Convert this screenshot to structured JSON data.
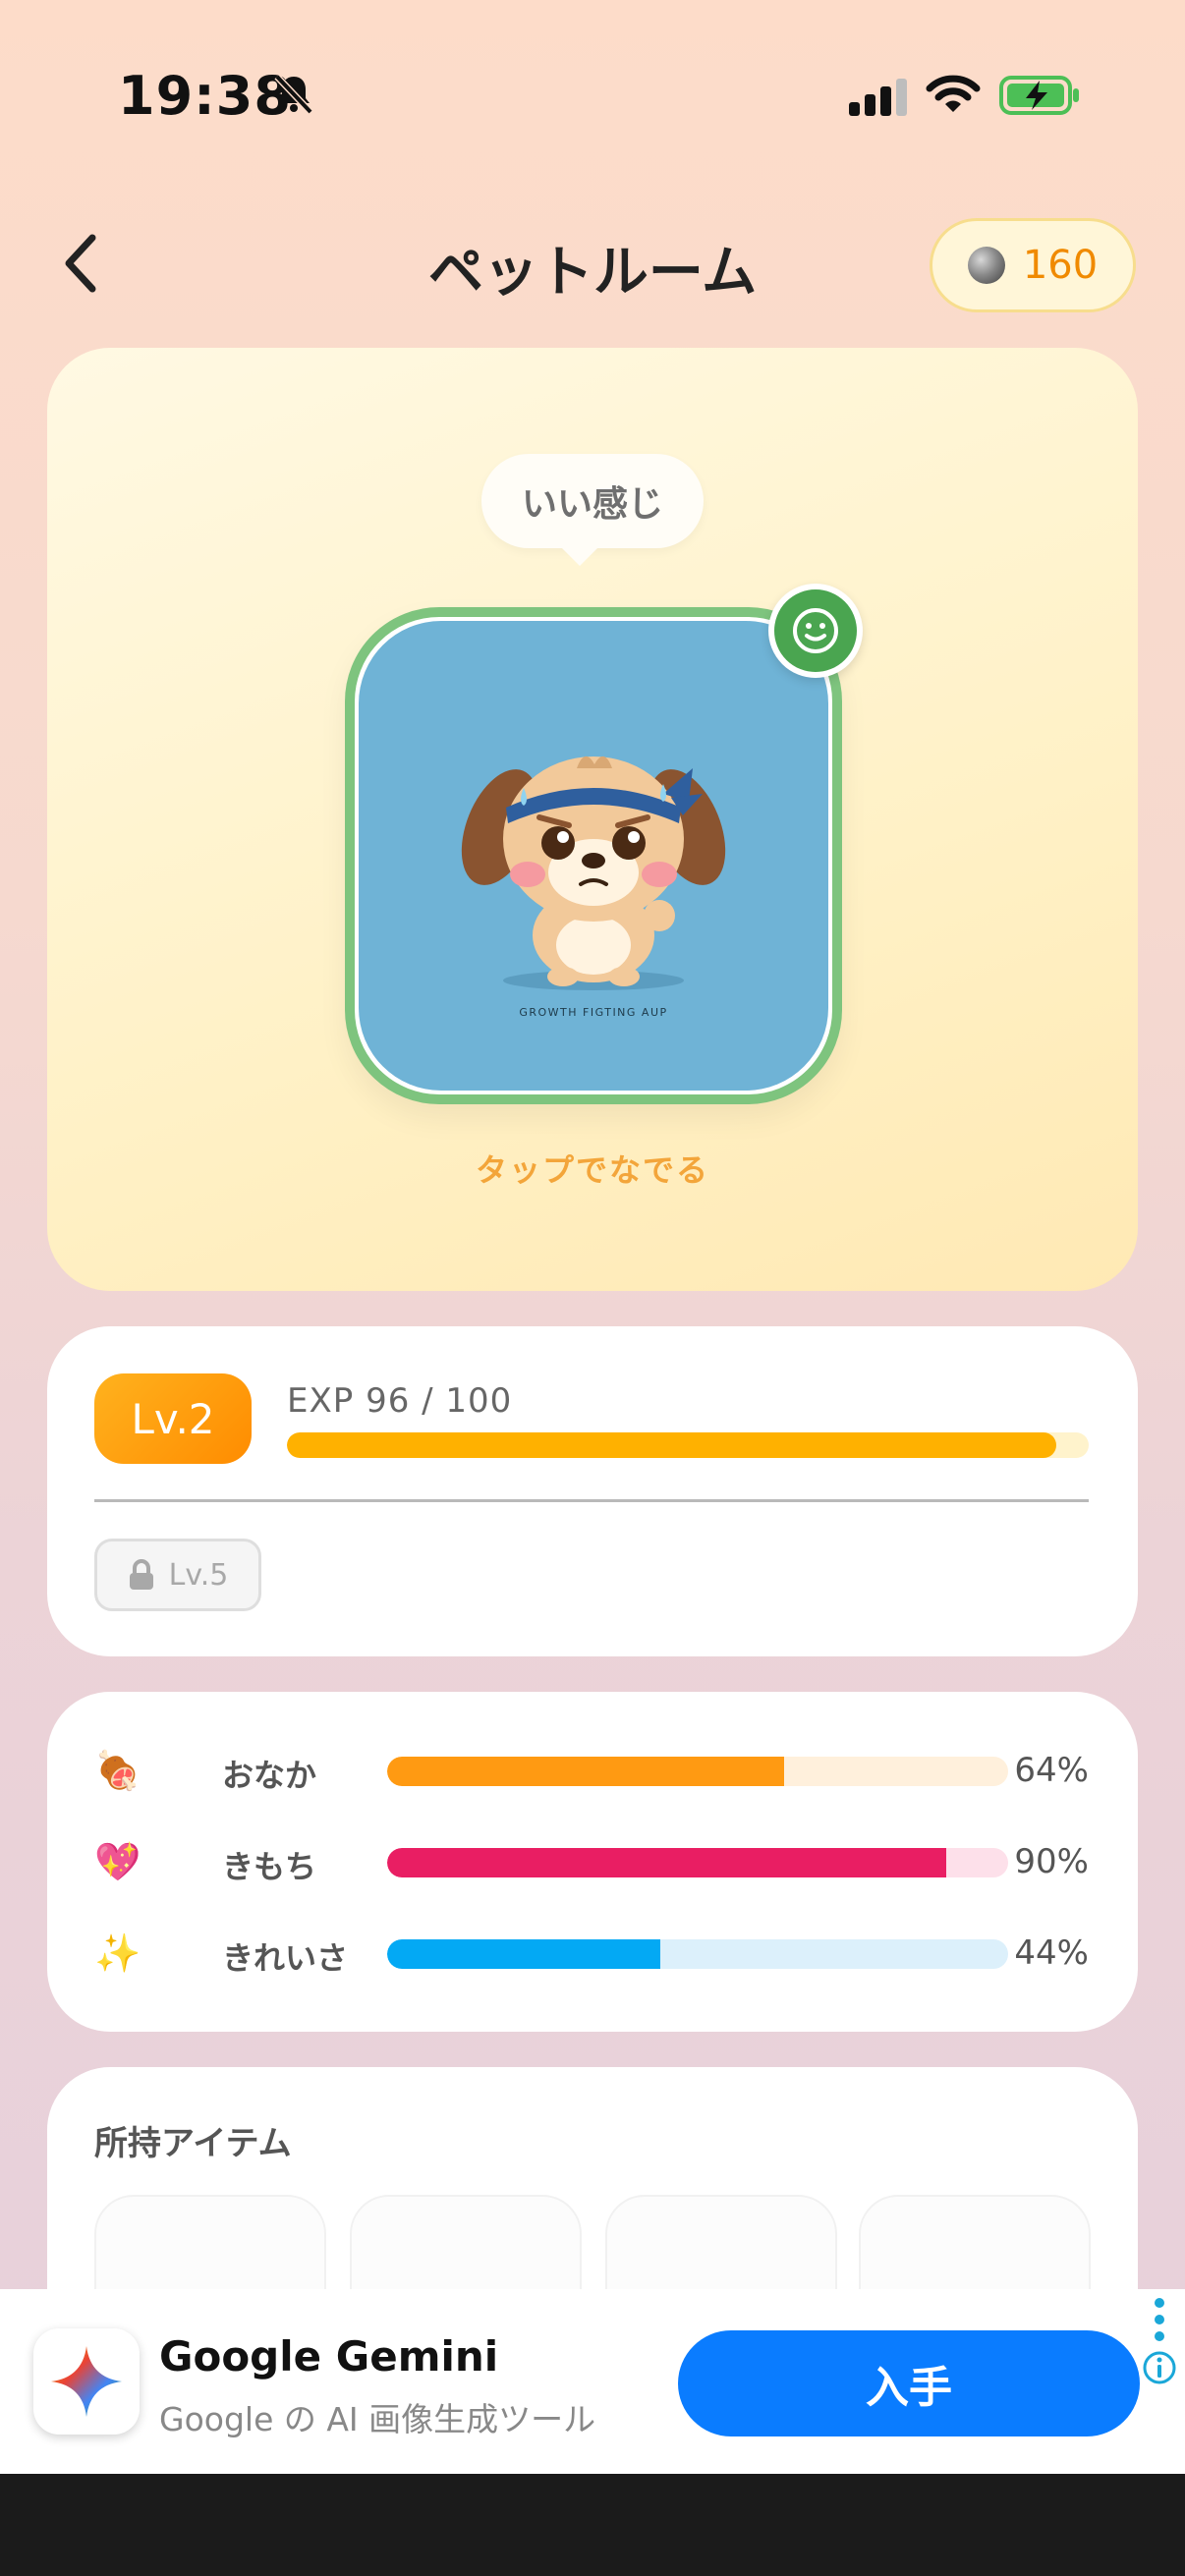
{
  "status_bar": {
    "time": "19:38",
    "icons": [
      "bell-slash-icon",
      "cellular-signal-icon",
      "wifi-icon",
      "battery-charging-icon"
    ]
  },
  "header": {
    "back_icon": "chevron-left-icon",
    "title": "ペットルーム",
    "coin_icon": "coin-icon",
    "coins": "160"
  },
  "pet": {
    "speech": "いい感じ",
    "mood_icon": "smiley-face-icon",
    "image_caption": "GROWTH FIGTING AUP",
    "tap_hint": "タップでなでる"
  },
  "level": {
    "label": "Lv.2",
    "exp_text": "EXP 96 / 100",
    "exp_fraction": 0.96,
    "locked_label": "Lv.5",
    "lock_icon": "lock-icon"
  },
  "stats": [
    {
      "icon": "meat-icon",
      "glyph": "🍖",
      "label": "おなか",
      "value": "64%",
      "fraction": 0.64,
      "color": "#ff9a12",
      "track": "#fff0dc"
    },
    {
      "icon": "sparkling-heart-icon",
      "glyph": "💖",
      "label": "きもち",
      "value": "90%",
      "fraction": 0.9,
      "color": "#e91e63",
      "track": "#fde0ea"
    },
    {
      "icon": "sparkles-icon",
      "glyph": "✨",
      "label": "きれいさ",
      "value": "44%",
      "fraction": 0.44,
      "color": "#03a9f4",
      "track": "#dcf0fb"
    }
  ],
  "items": {
    "title": "所持アイテム"
  },
  "ad": {
    "app_icon": "gemini-sparkle-icon",
    "title": "Google Gemini",
    "subtitle": "Google の AI 画像生成ツール",
    "cta": "入手",
    "menu_icon": "vertical-dots-icon",
    "info_icon": "info-icon"
  }
}
